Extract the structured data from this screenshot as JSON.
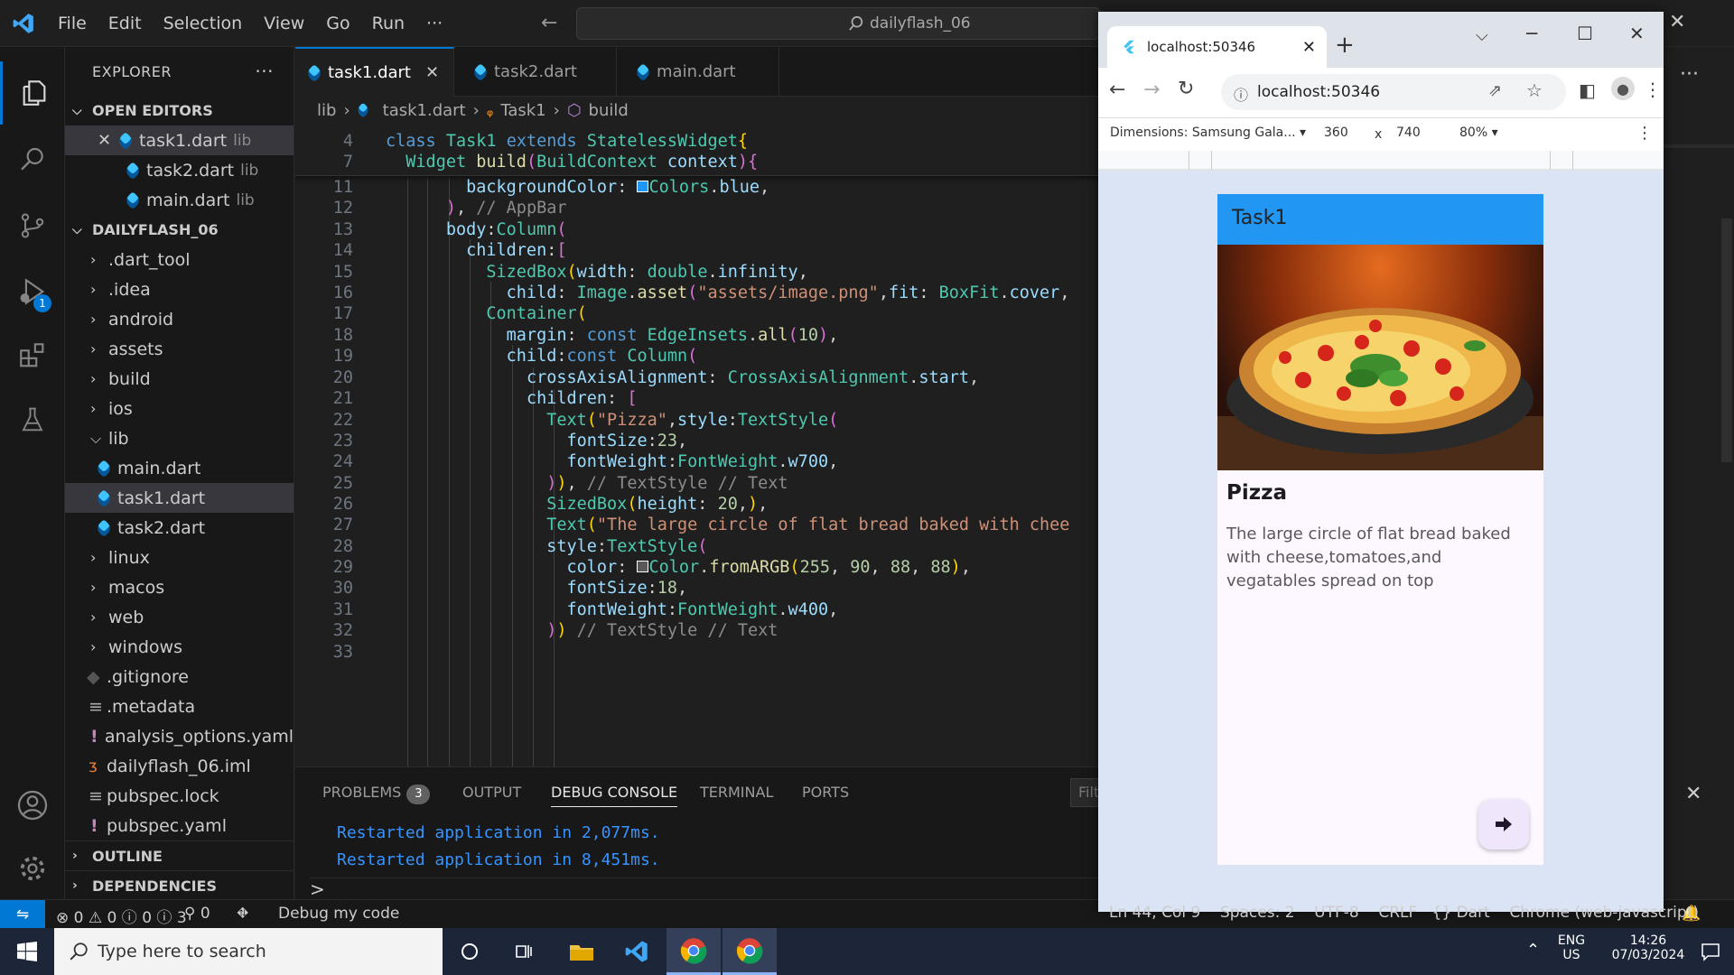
{
  "menu": {
    "file": "File",
    "edit": "Edit",
    "selection": "Selection",
    "view": "View",
    "go": "Go",
    "run": "Run",
    "more": "···"
  },
  "command_center": "dailyflash_06",
  "sidebar": {
    "title": "EXPLORER",
    "open_editors": "OPEN EDITORS",
    "open_files": [
      {
        "name": "task1.dart",
        "dir": "lib"
      },
      {
        "name": "task2.dart",
        "dir": "lib"
      },
      {
        "name": "main.dart",
        "dir": "lib"
      }
    ],
    "project": "DAILYFLASH_06",
    "tree": [
      ".dart_tool",
      ".idea",
      "android",
      "assets",
      "build",
      "ios",
      "lib",
      "main.dart",
      "task1.dart",
      "task2.dart",
      "linux",
      "macos",
      "web",
      "windows",
      ".gitignore",
      ".metadata",
      "analysis_options.yaml",
      "dailyflash_06.iml",
      "pubspec.lock",
      "pubspec.yaml"
    ],
    "outline": "OUTLINE",
    "dependencies": "DEPENDENCIES"
  },
  "activity_badge": "1",
  "tabs": [
    {
      "label": "task1.dart"
    },
    {
      "label": "task2.dart"
    },
    {
      "label": "main.dart"
    }
  ],
  "breadcrumb": {
    "a": "lib",
    "b": "task1.dart",
    "c": "Task1",
    "d": "build"
  },
  "editor": {
    "line_numbers": [
      "4",
      "7",
      "11",
      "12",
      "13",
      "14",
      "15",
      "16",
      "17",
      "18",
      "19",
      "20",
      "21",
      "22",
      "23",
      "24",
      "25",
      "26",
      "27",
      "28",
      "29",
      "30",
      "31",
      "32",
      "33"
    ]
  },
  "panel": {
    "problems": "PROBLEMS",
    "problems_count": "3",
    "output": "OUTPUT",
    "debug": "DEBUG CONSOLE",
    "terminal": "TERMINAL",
    "ports": "PORTS",
    "filter": "Filt",
    "lines": [
      "Restarted application in 2,077ms.",
      "Restarted application in 8,451ms."
    ],
    "prompt": ">"
  },
  "status": {
    "errors": "0",
    "warnings": "0",
    "info": "0",
    "hints": "3",
    "ports": "0",
    "debug": "Debug my code",
    "position": "Ln 44, Col 9",
    "spaces": "Spaces: 2",
    "encoding": "UTF-8",
    "eol": "CRLF",
    "language": "Dart",
    "device": "Chrome (web-javascript)",
    "braces": "{}"
  },
  "taskbar": {
    "search": "Type here to search",
    "lang1": "ENG",
    "lang2": "US",
    "time": "14:26",
    "date": "07/03/2024"
  },
  "chrome": {
    "tab_title": "localhost:50346",
    "url": "localhost:50346",
    "device": "Dimensions: Samsung Gala...",
    "width": "360",
    "x": "x",
    "height": "740",
    "zoom": "80%",
    "app_title": "Task1",
    "card_title": "Pizza",
    "card_text": "The large circle of flat bread baked with cheese,tomatoes,and vegatables spread on top"
  },
  "colors": {
    "accent": "#0078d4",
    "appbar": "#2196f3",
    "console": "#3794ff"
  }
}
